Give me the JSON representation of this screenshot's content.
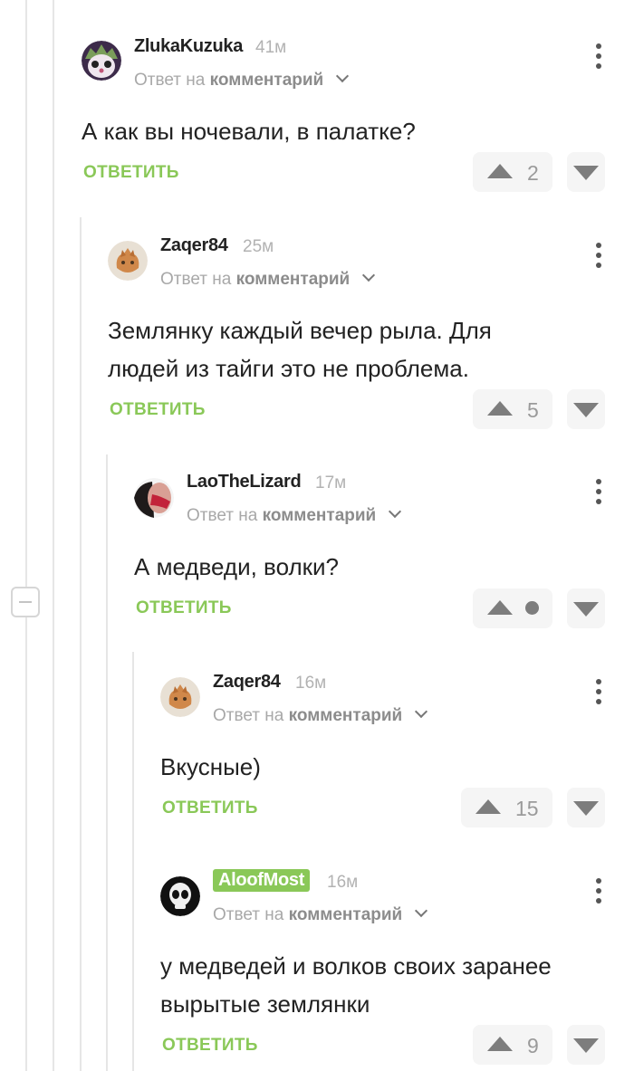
{
  "reply_prefix": "Ответ на",
  "reply_link": "комментарий",
  "reply_button": "ОТВЕТИТЬ",
  "colors": {
    "accent_green": "#8ac858",
    "text": "#222222",
    "muted": "#a8a8a8"
  },
  "comments": [
    {
      "author": "ZlukaKuzuka",
      "time": "41м",
      "author_badge": false,
      "avatar": "hedgehog-face-avatar",
      "text": [
        "А как вы ночевали, в палатке?"
      ],
      "rating": "2"
    },
    {
      "author": "Zaqer84",
      "time": "25м",
      "author_badge": false,
      "avatar": "ginger-cat-avatar",
      "text": [
        "Землянку каждый вечер рыла. Для",
        "людей из тайги это не проблема."
      ],
      "rating": "5"
    },
    {
      "author": "LaoTheLizard",
      "time": "17м",
      "author_badge": false,
      "avatar": "face-photo-avatar",
      "text": [
        "А медведи, волки?"
      ],
      "rating": null,
      "rating_icon": "neutral-dot-icon"
    },
    {
      "author": "Zaqer84",
      "time": "16м",
      "author_badge": false,
      "avatar": "ginger-cat-avatar",
      "text": [
        "Вкусные)"
      ],
      "rating": "15"
    },
    {
      "author": "AloofMost",
      "time": "16м",
      "author_badge": true,
      "avatar": "alien-skull-avatar",
      "text": [
        "у медведей и волков своих заранее",
        "вырытые землянки"
      ],
      "rating": "9"
    }
  ]
}
